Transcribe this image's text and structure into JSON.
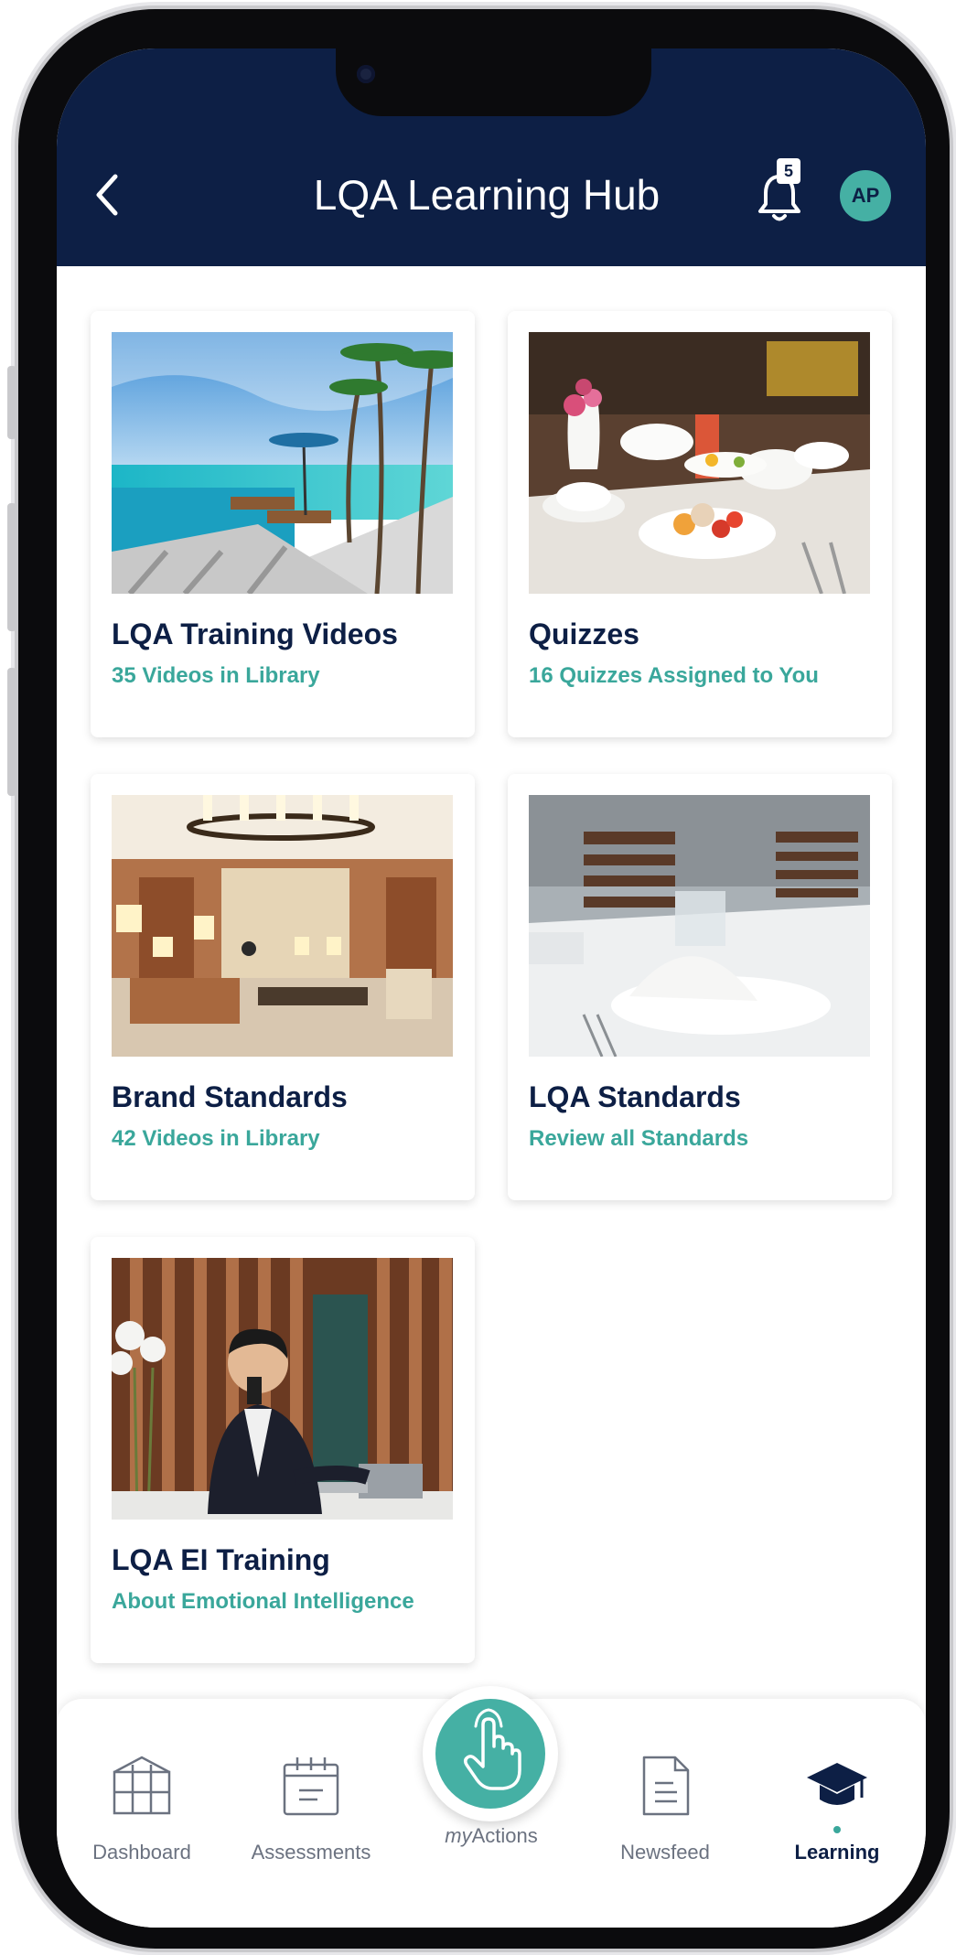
{
  "header": {
    "title": "LQA Learning Hub",
    "notification_count": "5",
    "avatar_initials": "AP"
  },
  "cards": [
    {
      "title": "LQA Training Videos",
      "subtitle": "35 Videos in Library",
      "image": "resort-pool-photo"
    },
    {
      "title": "Quizzes",
      "subtitle": "16 Quizzes Assigned to You",
      "image": "breakfast-table-photo"
    },
    {
      "title": "Brand Standards",
      "subtitle": "42 Videos in Library",
      "image": "hotel-lobby-photo"
    },
    {
      "title": "LQA Standards",
      "subtitle": "Review all Standards",
      "image": "table-setting-photo"
    },
    {
      "title": "LQA EI Training",
      "subtitle": "About  Emotional Intelligence",
      "image": "front-desk-agent-photo"
    }
  ],
  "tabbar": {
    "dashboard": "Dashboard",
    "assessments": "Assessments",
    "myactions_prefix": "my",
    "myactions_suffix": "Actions",
    "newsfeed": "Newsfeed",
    "learning": "Learning",
    "active_tab": "Learning"
  },
  "colors": {
    "header_bg": "#0d1f45",
    "accent_teal": "#45b0a4",
    "subtitle_teal": "#3aa79b",
    "title_navy": "#0d1f45"
  }
}
